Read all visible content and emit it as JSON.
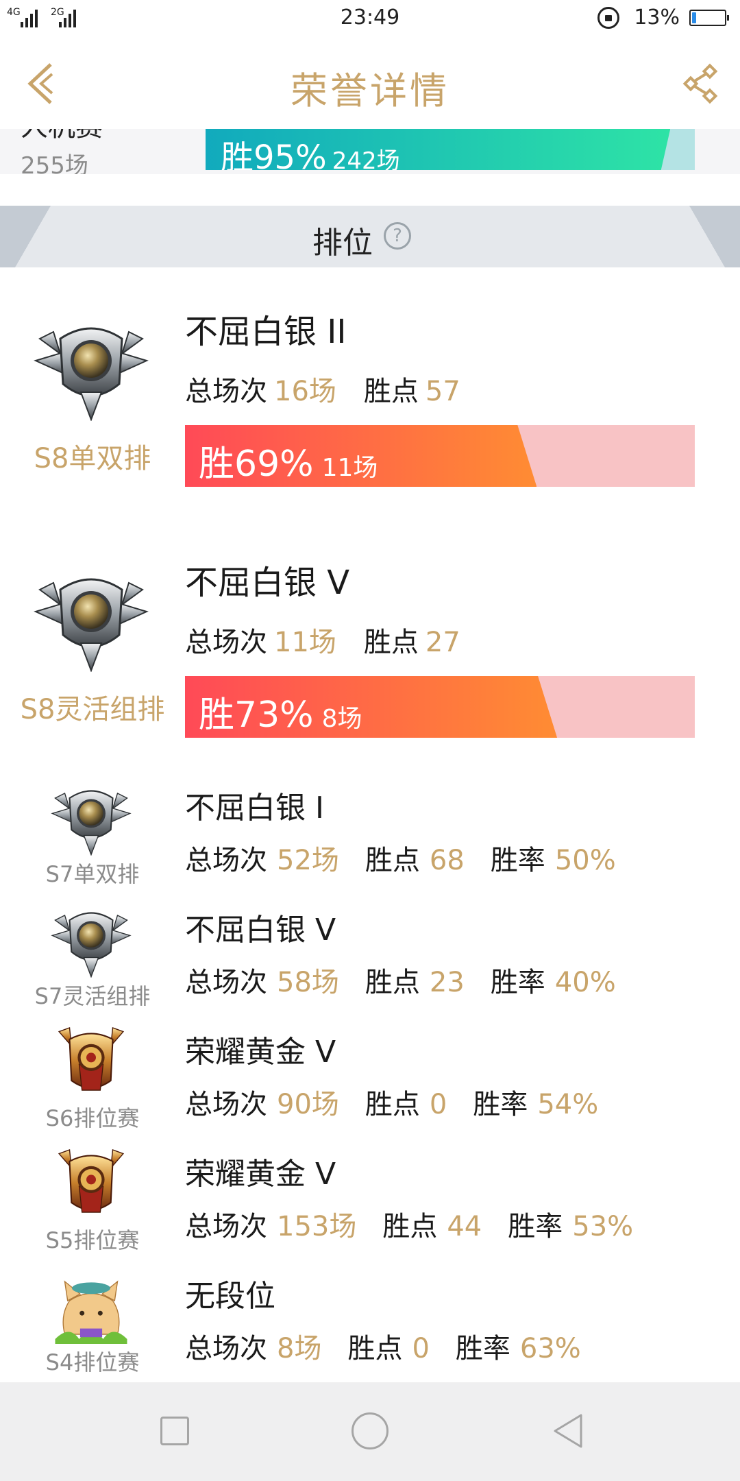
{
  "status_bar": {
    "net1": "4G",
    "net2": "2G",
    "time": "23:49",
    "battery_pct": "13%",
    "battery_level": 0.13,
    "icons": [
      "signal-icon",
      "lock-rotation-icon",
      "battery-icon"
    ]
  },
  "header": {
    "title": "荣誉详情",
    "back_icon": "chevron-left-icon",
    "share_icon": "share-icon",
    "accent": "#c8a46a"
  },
  "partial_row": {
    "name": "人机赛",
    "total": "255场",
    "win_pct": "胜95%",
    "wins": "242场",
    "win_rate": 0.95
  },
  "section": {
    "title": "排位",
    "help_glyph": "?"
  },
  "labels": {
    "total": "总场次",
    "points": "胜点",
    "rate": "胜率"
  },
  "big_rows": [
    {
      "rank": "不屈白银 II",
      "season": "S8单双排",
      "total": "16场",
      "points": "57",
      "win_pct": "胜69%",
      "wins": "11场",
      "win_rate": 0.69,
      "badge": "silver-badge"
    },
    {
      "rank": "不屈白银 V",
      "season": "S8灵活组排",
      "total": "11场",
      "points": "27",
      "win_pct": "胜73%",
      "wins": "8场",
      "win_rate": 0.73,
      "badge": "silver-badge"
    }
  ],
  "small_rows": [
    {
      "rank": "不屈白银 I",
      "season": "S7单双排",
      "total": "52场",
      "points": "68",
      "rate": "50%",
      "badge": "silver-badge"
    },
    {
      "rank": "不屈白银 V",
      "season": "S7灵活组排",
      "total": "58场",
      "points": "23",
      "rate": "40%",
      "badge": "silver-badge"
    },
    {
      "rank": "荣耀黄金 V",
      "season": "S6排位赛",
      "total": "90场",
      "points": "0",
      "rate": "54%",
      "badge": "gold-badge"
    },
    {
      "rank": "荣耀黄金 V",
      "season": "S5排位赛",
      "total": "153场",
      "points": "44",
      "rate": "53%",
      "badge": "gold-badge"
    },
    {
      "rank": "无段位",
      "season": "S4排位赛",
      "total": "8场",
      "points": "0",
      "rate": "63%",
      "badge": "unranked-avatar"
    }
  ],
  "nav_bar": {
    "icons": [
      "recents-square-icon",
      "home-circle-icon",
      "back-triangle-icon"
    ]
  }
}
